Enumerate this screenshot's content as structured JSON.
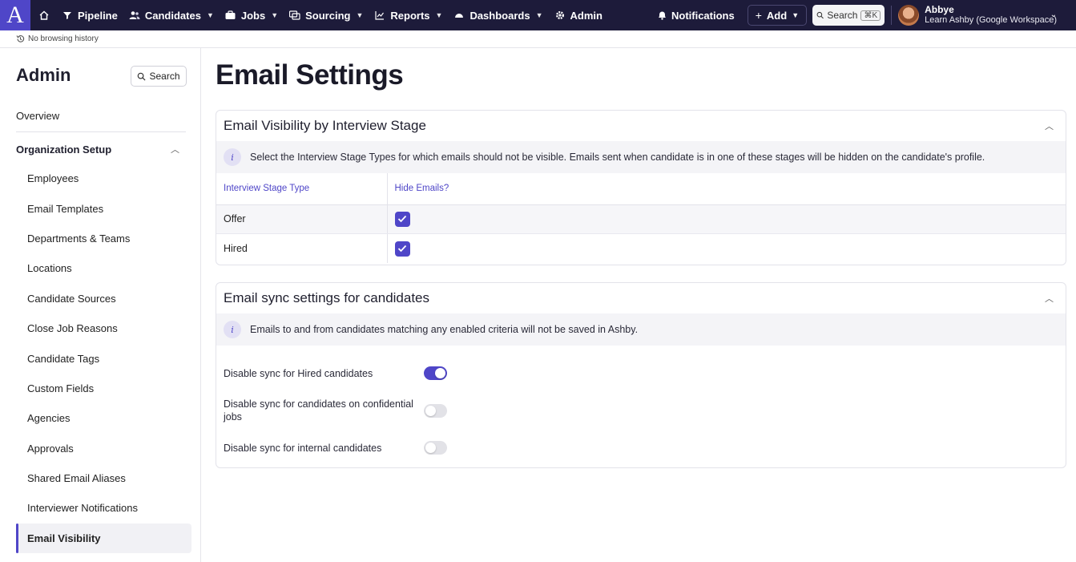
{
  "topnav": {
    "logo_text": "A",
    "items": [
      {
        "label": "Pipeline",
        "icon": "funnel-icon",
        "has_menu": false
      },
      {
        "label": "Candidates",
        "icon": "people-icon",
        "has_menu": true
      },
      {
        "label": "Jobs",
        "icon": "briefcase-icon",
        "has_menu": true
      },
      {
        "label": "Sourcing",
        "icon": "sourcing-icon",
        "has_menu": true
      },
      {
        "label": "Reports",
        "icon": "chart-icon",
        "has_menu": true
      },
      {
        "label": "Dashboards",
        "icon": "gauge-icon",
        "has_menu": true
      },
      {
        "label": "Admin",
        "icon": "gear-icon",
        "has_menu": false
      }
    ],
    "notifications_label": "Notifications",
    "add_label": "Add",
    "search_label": "Search",
    "search_shortcut": "⌘K",
    "user_name": "Abbye",
    "user_org": "Learn Ashby (Google Workspace)"
  },
  "history": {
    "label": "No browsing history"
  },
  "sidebar": {
    "title": "Admin",
    "search_label": "Search",
    "overview_label": "Overview",
    "group_label": "Organization Setup",
    "items": [
      {
        "label": "Employees"
      },
      {
        "label": "Email Templates"
      },
      {
        "label": "Departments & Teams"
      },
      {
        "label": "Locations"
      },
      {
        "label": "Candidate Sources"
      },
      {
        "label": "Close Job Reasons"
      },
      {
        "label": "Candidate Tags"
      },
      {
        "label": "Custom Fields"
      },
      {
        "label": "Agencies"
      },
      {
        "label": "Approvals"
      },
      {
        "label": "Shared Email Aliases"
      },
      {
        "label": "Interviewer Notifications"
      },
      {
        "label": "Email Visibility"
      }
    ],
    "active_item": "Email Visibility"
  },
  "main": {
    "title": "Email Settings",
    "visibility": {
      "title": "Email Visibility by Interview Stage",
      "info": "Select the Interview Stage Types for which emails should not be visible. Emails sent when candidate is in one of these stages will be hidden on the candidate's profile.",
      "columns": [
        "Interview Stage Type",
        "Hide Emails?"
      ],
      "rows": [
        {
          "stage": "Offer",
          "hidden": true
        },
        {
          "stage": "Hired",
          "hidden": true
        }
      ]
    },
    "sync": {
      "title": "Email sync settings for candidates",
      "info": "Emails to and from candidates matching any enabled criteria will not be saved in Ashby.",
      "toggles": [
        {
          "label": "Disable sync for Hired candidates",
          "enabled": true
        },
        {
          "label": "Disable sync for candidates on confidential jobs",
          "enabled": false
        },
        {
          "label": "Disable sync for internal candidates",
          "enabled": false
        }
      ]
    }
  },
  "colors": {
    "accent": "#4f46c8",
    "nav_bg": "#1d1b3a"
  }
}
